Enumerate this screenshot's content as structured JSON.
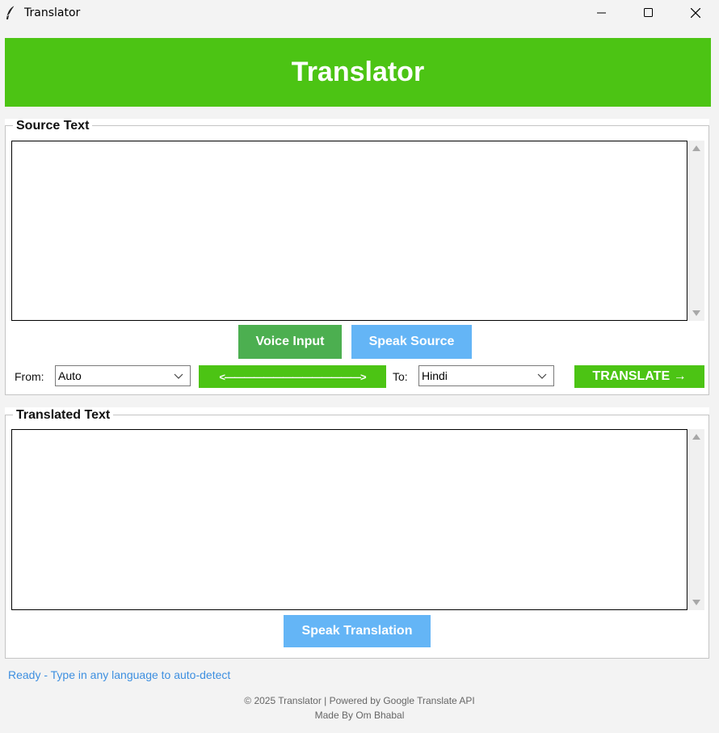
{
  "window": {
    "title": "Translator"
  },
  "header": {
    "title": "Translator"
  },
  "source": {
    "legend": "Source Text",
    "voice_input_label": "Voice Input",
    "speak_source_label": "Speak Source",
    "from_label": "From:",
    "from_value": "Auto",
    "swap_label": "<——————————————>",
    "to_label": "To:",
    "to_value": "Hindi",
    "translate_label": "TRANSLATE →"
  },
  "translated": {
    "legend": "Translated Text",
    "speak_translation_label": "Speak Translation"
  },
  "status": {
    "text": "Ready - Type in any language to auto-detect"
  },
  "footer": {
    "line1": "© 2025 Translator | Powered by Google Translate API",
    "line2": "Made By Om Bhabal"
  },
  "colors": {
    "accent_green": "#4cc414",
    "voice_green": "#4caf50",
    "speak_blue": "#64b5f6",
    "status_blue": "#3d8fe0"
  },
  "icons": [
    "feather-icon",
    "minimize-icon",
    "maximize-icon",
    "close-icon",
    "chevron-down-icon"
  ]
}
